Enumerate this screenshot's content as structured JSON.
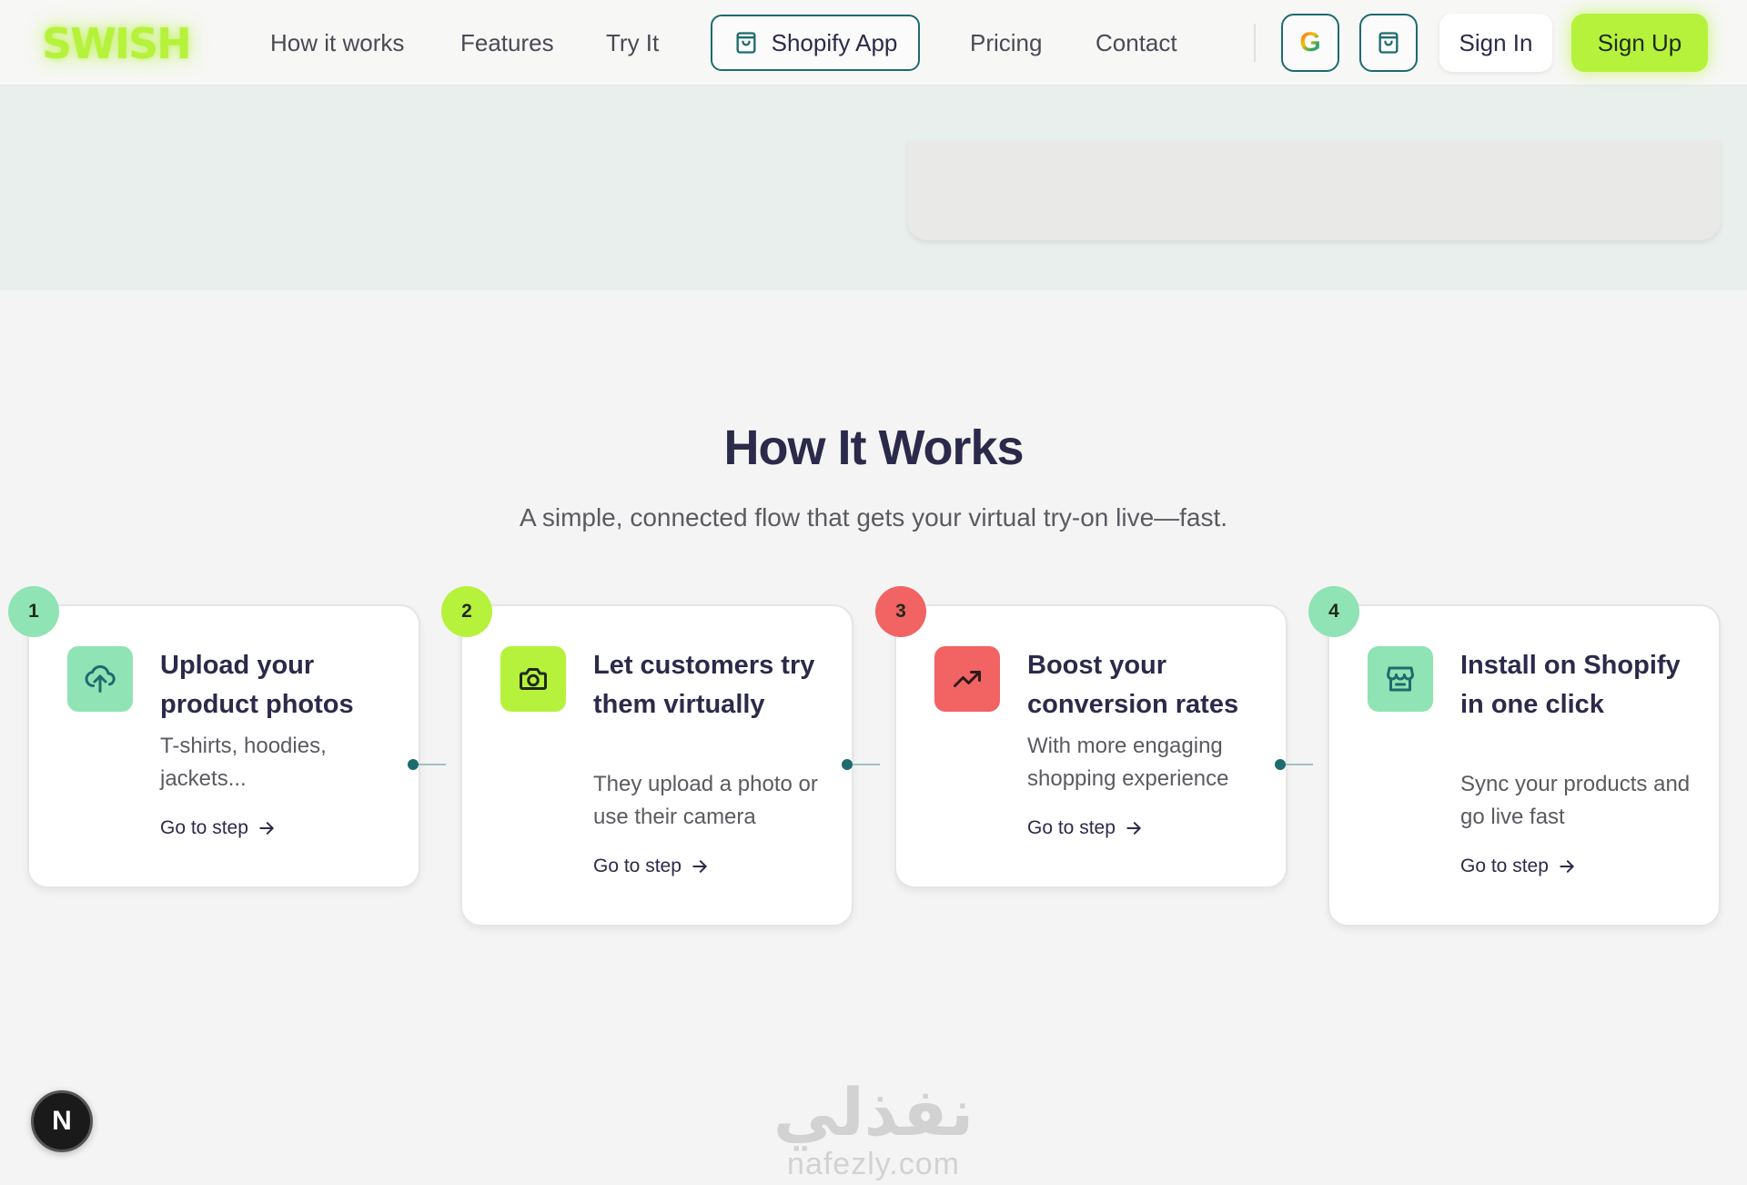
{
  "nav": {
    "logo": "SWISH",
    "links": [
      "How it works",
      "Features",
      "Try It",
      "Pricing",
      "Contact"
    ],
    "shopify_label": "Shopify App",
    "google_icon_letter": "G",
    "signin_label": "Sign In",
    "signup_label": "Sign Up"
  },
  "how": {
    "title": "How It Works",
    "subtitle": "A simple, connected flow that gets your virtual try-on live—fast.",
    "steps": [
      {
        "number": "1",
        "title": "Upload your product photos",
        "desc": "T-shirts, hoodies, jackets...",
        "link": "Go to step",
        "icon": "upload-cloud-icon",
        "badge_color": "#8fe3b4",
        "icon_color": "#8fe3b4"
      },
      {
        "number": "2",
        "title": "Let customers try them virtually",
        "desc": "They upload a photo or use their camera",
        "link": "Go to step",
        "icon": "camera-icon",
        "badge_color": "#b6f23b",
        "icon_color": "#b6f23b"
      },
      {
        "number": "3",
        "title": "Boost your conversion rates",
        "desc": "With more engaging shopping experience",
        "link": "Go to step",
        "icon": "trending-up-icon",
        "badge_color": "#f26363",
        "icon_color": "#f26363"
      },
      {
        "number": "4",
        "title": "Install on Shopify in one click",
        "desc": "Sync your products and go live fast",
        "link": "Go to step",
        "icon": "store-icon",
        "badge_color": "#8fe3b4",
        "icon_color": "#8fe3b4"
      }
    ]
  },
  "dev_button": {
    "label": "N"
  },
  "watermark": {
    "arabic": "نفذلي",
    "latin": "nafezly.com"
  },
  "colors": {
    "accent": "#b6f23b",
    "teal": "#1d6b6e",
    "text_dark": "#2c2a4a"
  }
}
